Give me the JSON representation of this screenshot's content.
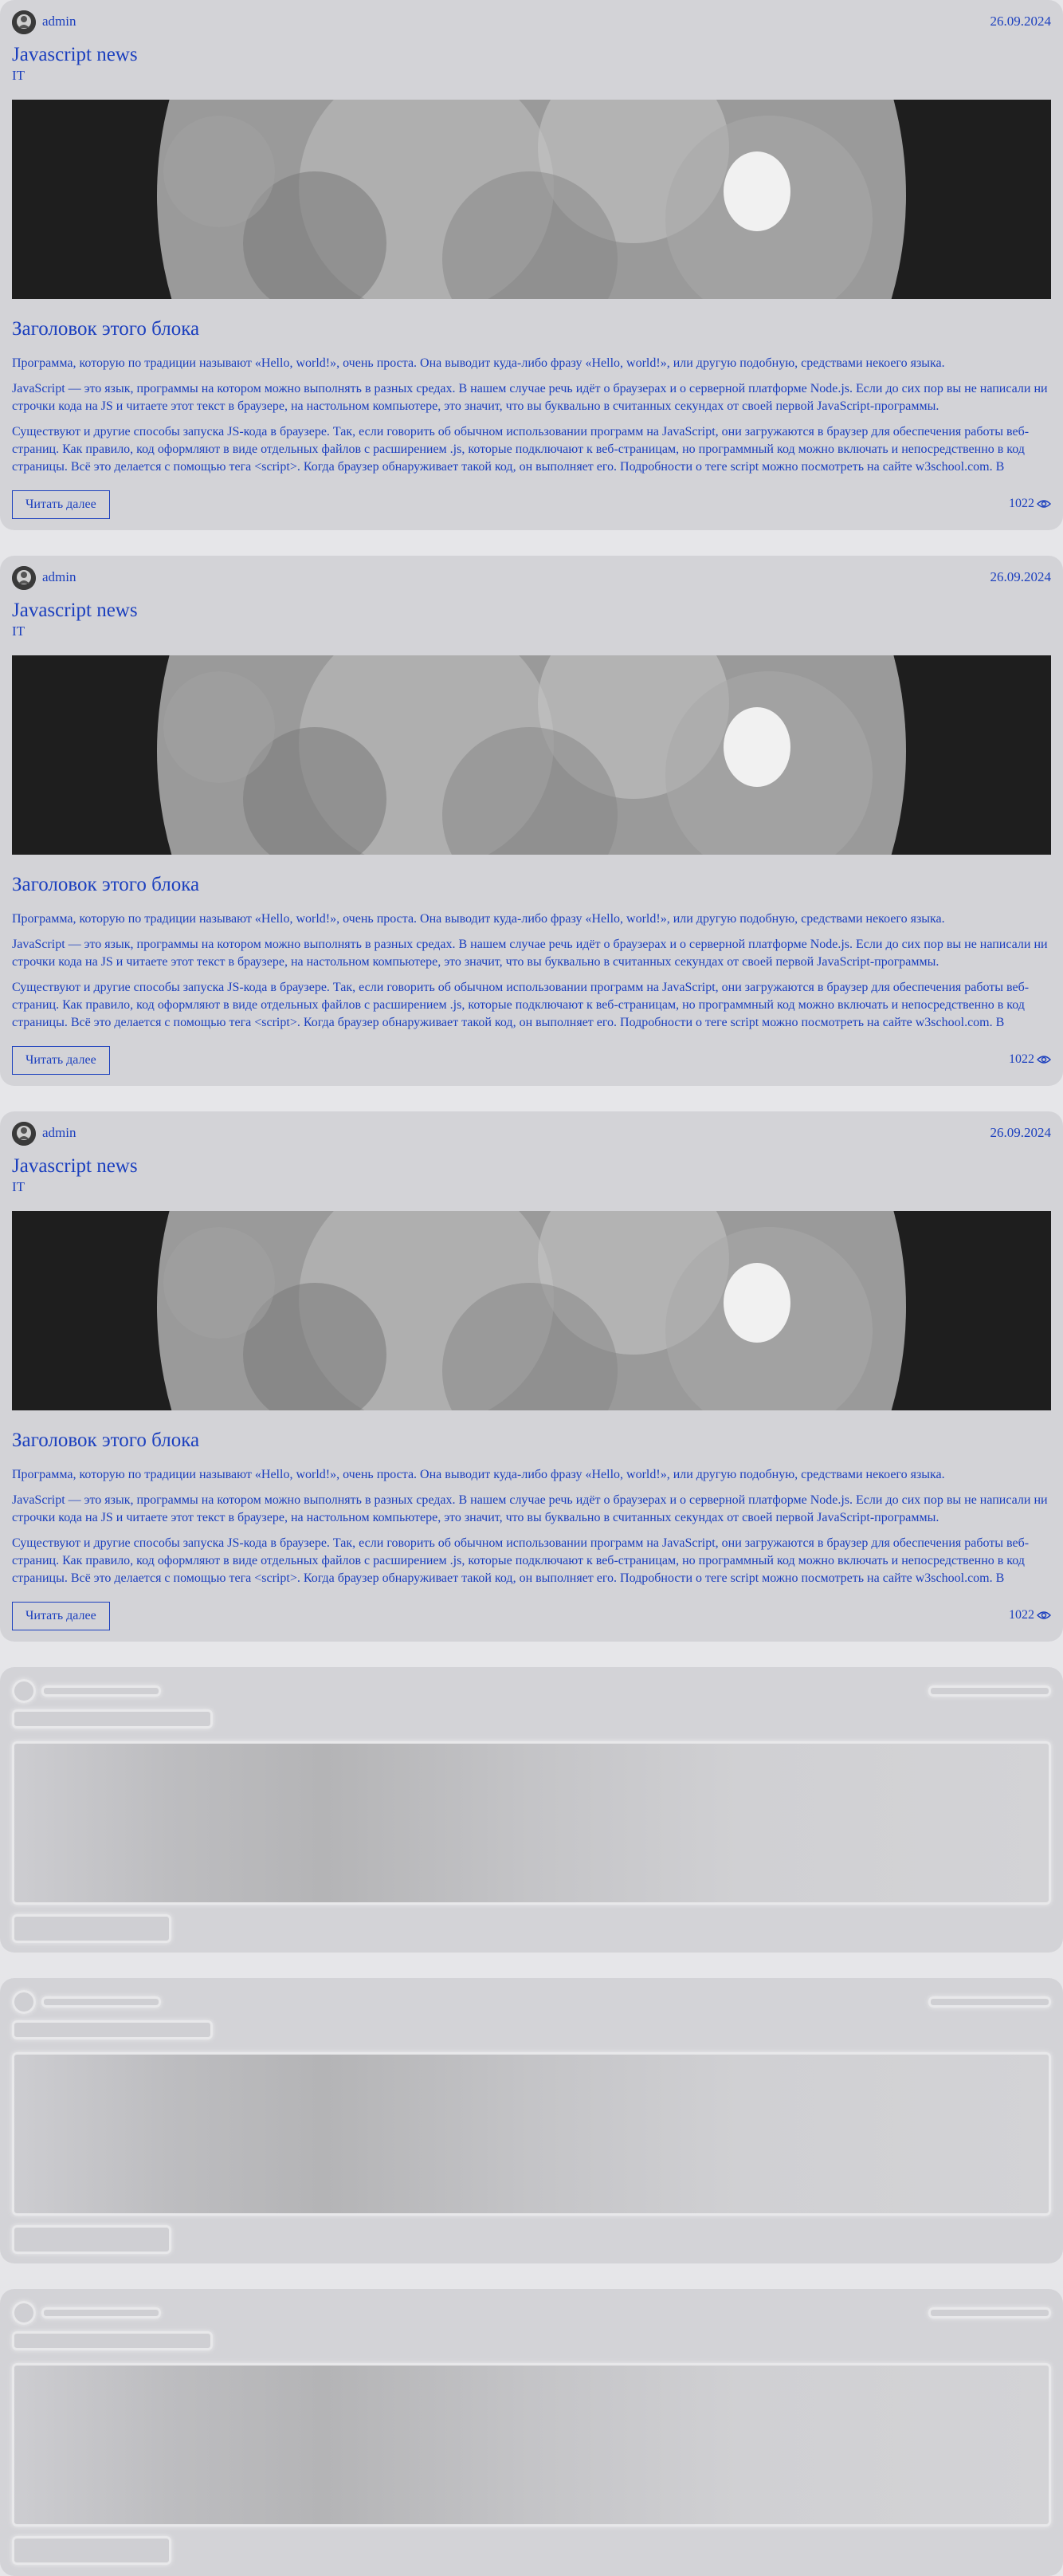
{
  "posts": [
    {
      "author": "admin",
      "date": "26.09.2024",
      "title": "Javascript news",
      "category": "IT",
      "block_title": "Заголовок этого блока",
      "paragraphs": [
        "Программа, которую по традиции называют «Hello, world!», очень проста. Она выводит куда-либо фразу «Hello, world!», или другую подобную, средствами некоего языка.",
        "JavaScript — это язык, программы на котором можно выполнять в разных средах. В нашем случае речь идёт о браузерах и о серверной платформе Node.js. Если до сих пор вы не написали ни строчки кода на JS и читаете этот текст в браузере, на настольном компьютере, это значит, что вы буквально в считанных секундах от своей первой JavaScript-программы.",
        "Существуют и другие способы запуска JS-кода в браузере. Так, если говорить об обычном использовании программ на JavaScript, они загружаются в браузер для обеспечения работы веб-страниц. Как правило, код оформляют в виде отдельных файлов с расширением .js, которые подключают к веб-страницам, но программный код можно включать и непосредственно в код страницы. Всё это делается с помощью тега <script>. Когда браузер обнаруживает такой код, он выполняет его. Подробности о теге script можно посмотреть на сайте w3school.com. В"
      ],
      "read_more": "Читать далее",
      "views": "1022"
    },
    {
      "author": "admin",
      "date": "26.09.2024",
      "title": "Javascript news",
      "category": "IT",
      "block_title": "Заголовок этого блока",
      "paragraphs": [
        "Программа, которую по традиции называют «Hello, world!», очень проста. Она выводит куда-либо фразу «Hello, world!», или другую подобную, средствами некоего языка.",
        "JavaScript — это язык, программы на котором можно выполнять в разных средах. В нашем случае речь идёт о браузерах и о серверной платформе Node.js. Если до сих пор вы не написали ни строчки кода на JS и читаете этот текст в браузере, на настольном компьютере, это значит, что вы буквально в считанных секундах от своей первой JavaScript-программы.",
        "Существуют и другие способы запуска JS-кода в браузере. Так, если говорить об обычном использовании программ на JavaScript, они загружаются в браузер для обеспечения работы веб-страниц. Как правило, код оформляют в виде отдельных файлов с расширением .js, которые подключают к веб-страницам, но программный код можно включать и непосредственно в код страницы. Всё это делается с помощью тега <script>. Когда браузер обнаруживает такой код, он выполняет его. Подробности о теге script можно посмотреть на сайте w3school.com. В"
      ],
      "read_more": "Читать далее",
      "views": "1022"
    },
    {
      "author": "admin",
      "date": "26.09.2024",
      "title": "Javascript news",
      "category": "IT",
      "block_title": "Заголовок этого блока",
      "paragraphs": [
        "Программа, которую по традиции называют «Hello, world!», очень проста. Она выводит куда-либо фразу «Hello, world!», или другую подобную, средствами некоего языка.",
        "JavaScript — это язык, программы на котором можно выполнять в разных средах. В нашем случае речь идёт о браузерах и о серверной платформе Node.js. Если до сих пор вы не написали ни строчки кода на JS и читаете этот текст в браузере, на настольном компьютере, это значит, что вы буквально в считанных секундах от своей первой JavaScript-программы.",
        "Существуют и другие способы запуска JS-кода в браузере. Так, если говорить об обычном использовании программ на JavaScript, они загружаются в браузер для обеспечения работы веб-страниц. Как правило, код оформляют в виде отдельных файлов с расширением .js, которые подключают к веб-страницам, но программный код можно включать и непосредственно в код страницы. Всё это делается с помощью тега <script>. Когда браузер обнаруживает такой код, он выполняет его. Подробности о теге script можно посмотреть на сайте w3school.com. В"
      ],
      "read_more": "Читать далее",
      "views": "1022"
    }
  ],
  "icons": {
    "avatar": "avatar-icon",
    "views": "eye-icon",
    "cover": "moon-image"
  },
  "colors": {
    "accent": "#1b3fbe",
    "card_bg": "#d3d3d7",
    "page_bg": "#e6e6e9"
  },
  "skeleton_count": 3
}
